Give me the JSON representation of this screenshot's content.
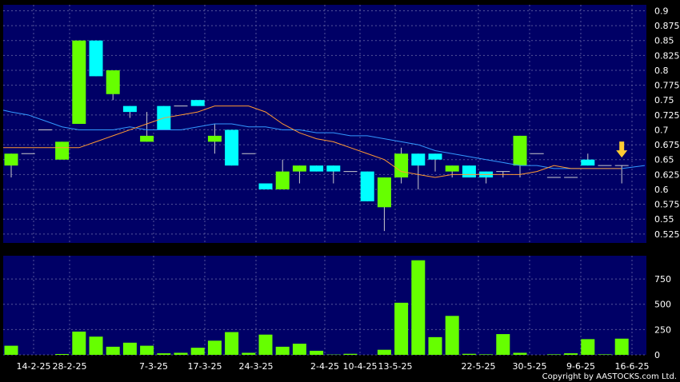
{
  "chart_data": {
    "type": "candlestick",
    "price_axis": {
      "ylim": [
        0.51,
        0.91
      ],
      "ticks": [
        0.525,
        0.55,
        0.575,
        0.6,
        0.625,
        0.65,
        0.675,
        0.7,
        0.725,
        0.75,
        0.775,
        0.8,
        0.825,
        0.85,
        0.875,
        0.9
      ]
    },
    "volume_axis": {
      "ylim": [
        0,
        980
      ],
      "ticks": [
        0,
        250,
        500,
        750
      ]
    },
    "x_labels": [
      "14-2-25",
      "28-2-25",
      "7-3-25",
      "17-3-25",
      "24-3-25",
      "2-4-25",
      "10-4-25",
      "13-5-25",
      "22-5-25",
      "30-5-25",
      "9-6-25",
      "16-6-25"
    ],
    "candles": [
      {
        "open": 0.64,
        "close": 0.66,
        "high": 0.66,
        "low": 0.62,
        "volume": 90
      },
      {
        "open": 0.66,
        "close": 0.66,
        "high": 0.66,
        "low": 0.66,
        "volume": 0
      },
      {
        "open": 0.7,
        "close": 0.7,
        "high": 0.7,
        "low": 0.7,
        "volume": 0
      },
      {
        "open": 0.65,
        "close": 0.68,
        "high": 0.68,
        "low": 0.65,
        "volume": 8
      },
      {
        "open": 0.71,
        "close": 0.85,
        "high": 0.85,
        "low": 0.71,
        "volume": 230
      },
      {
        "open": 0.85,
        "close": 0.79,
        "high": 0.85,
        "low": 0.79,
        "volume": 180
      },
      {
        "open": 0.76,
        "close": 0.8,
        "high": 0.8,
        "low": 0.75,
        "volume": 80
      },
      {
        "open": 0.74,
        "close": 0.73,
        "high": 0.74,
        "low": 0.72,
        "volume": 120
      },
      {
        "open": 0.68,
        "close": 0.69,
        "high": 0.73,
        "low": 0.68,
        "volume": 90
      },
      {
        "open": 0.74,
        "close": 0.7,
        "high": 0.74,
        "low": 0.7,
        "volume": 15
      },
      {
        "open": 0.74,
        "close": 0.74,
        "high": 0.74,
        "low": 0.74,
        "volume": 20
      },
      {
        "open": 0.75,
        "close": 0.74,
        "high": 0.75,
        "low": 0.74,
        "volume": 70
      },
      {
        "open": 0.68,
        "close": 0.69,
        "high": 0.71,
        "low": 0.66,
        "volume": 140
      },
      {
        "open": 0.7,
        "close": 0.64,
        "high": 0.7,
        "low": 0.64,
        "volume": 225
      },
      {
        "open": 0.66,
        "close": 0.66,
        "high": 0.66,
        "low": 0.66,
        "volume": 20
      },
      {
        "open": 0.61,
        "close": 0.6,
        "high": 0.61,
        "low": 0.6,
        "volume": 200
      },
      {
        "open": 0.6,
        "close": 0.63,
        "high": 0.65,
        "low": 0.6,
        "volume": 80
      },
      {
        "open": 0.63,
        "close": 0.64,
        "high": 0.64,
        "low": 0.61,
        "volume": 110
      },
      {
        "open": 0.64,
        "close": 0.63,
        "high": 0.64,
        "low": 0.63,
        "volume": 40
      },
      {
        "open": 0.64,
        "close": 0.63,
        "high": 0.64,
        "low": 0.61,
        "volume": 3
      },
      {
        "open": 0.63,
        "close": 0.63,
        "high": 0.63,
        "low": 0.63,
        "volume": 10
      },
      {
        "open": 0.63,
        "close": 0.58,
        "high": 0.63,
        "low": 0.58,
        "volume": 0
      },
      {
        "open": 0.57,
        "close": 0.62,
        "high": 0.62,
        "low": 0.53,
        "volume": 50
      },
      {
        "open": 0.62,
        "close": 0.66,
        "high": 0.67,
        "low": 0.61,
        "volume": 515
      },
      {
        "open": 0.66,
        "close": 0.64,
        "high": 0.66,
        "low": 0.6,
        "volume": 935
      },
      {
        "open": 0.66,
        "close": 0.65,
        "high": 0.66,
        "low": 0.63,
        "volume": 175
      },
      {
        "open": 0.63,
        "close": 0.64,
        "high": 0.64,
        "low": 0.62,
        "volume": 385
      },
      {
        "open": 0.64,
        "close": 0.62,
        "high": 0.64,
        "low": 0.62,
        "volume": 10
      },
      {
        "open": 0.63,
        "close": 0.62,
        "high": 0.63,
        "low": 0.61,
        "volume": 5
      },
      {
        "open": 0.63,
        "close": 0.63,
        "high": 0.63,
        "low": 0.62,
        "volume": 205
      },
      {
        "open": 0.64,
        "close": 0.69,
        "high": 0.69,
        "low": 0.62,
        "volume": 20
      },
      {
        "open": 0.66,
        "close": 0.66,
        "high": 0.66,
        "low": 0.66,
        "volume": 0
      },
      {
        "open": 0.62,
        "close": 0.62,
        "high": 0.62,
        "low": 0.62,
        "volume": 5
      },
      {
        "open": 0.62,
        "close": 0.62,
        "high": 0.62,
        "low": 0.62,
        "volume": 15
      },
      {
        "open": 0.65,
        "close": 0.64,
        "high": 0.66,
        "low": 0.64,
        "volume": 155
      },
      {
        "open": 0.64,
        "close": 0.64,
        "high": 0.64,
        "low": 0.64,
        "volume": 5
      },
      {
        "open": 0.64,
        "close": 0.64,
        "high": 0.64,
        "low": 0.61,
        "volume": 160
      }
    ],
    "ma_short": {
      "color": "#ff9933",
      "values": [
        0.67,
        0.67,
        0.67,
        0.67,
        0.67,
        0.68,
        0.69,
        0.7,
        0.71,
        0.72,
        0.725,
        0.73,
        0.74,
        0.74,
        0.74,
        0.73,
        0.71,
        0.695,
        0.685,
        0.68,
        0.67,
        0.66,
        0.65,
        0.63,
        0.625,
        0.62,
        0.625,
        0.625,
        0.625,
        0.625,
        0.625,
        0.63,
        0.64,
        0.635,
        0.635,
        0.635,
        0.635
      ]
    },
    "ma_long": {
      "color": "#3399ff",
      "values": [
        0.73,
        0.725,
        0.715,
        0.705,
        0.7,
        0.7,
        0.7,
        0.705,
        0.7,
        0.7,
        0.7,
        0.705,
        0.71,
        0.71,
        0.705,
        0.705,
        0.7,
        0.7,
        0.695,
        0.695,
        0.69,
        0.69,
        0.685,
        0.68,
        0.675,
        0.665,
        0.66,
        0.655,
        0.65,
        0.645,
        0.64,
        0.64,
        0.635,
        0.635,
        0.635,
        0.635,
        0.635
      ]
    },
    "colors": {
      "up": "#66ff00",
      "down": "#00ffff",
      "background": "#000066",
      "grid": "#555599",
      "arrow": "#ffcc33"
    },
    "copyright": "Copyright by AASTOCKS.com Ltd."
  }
}
